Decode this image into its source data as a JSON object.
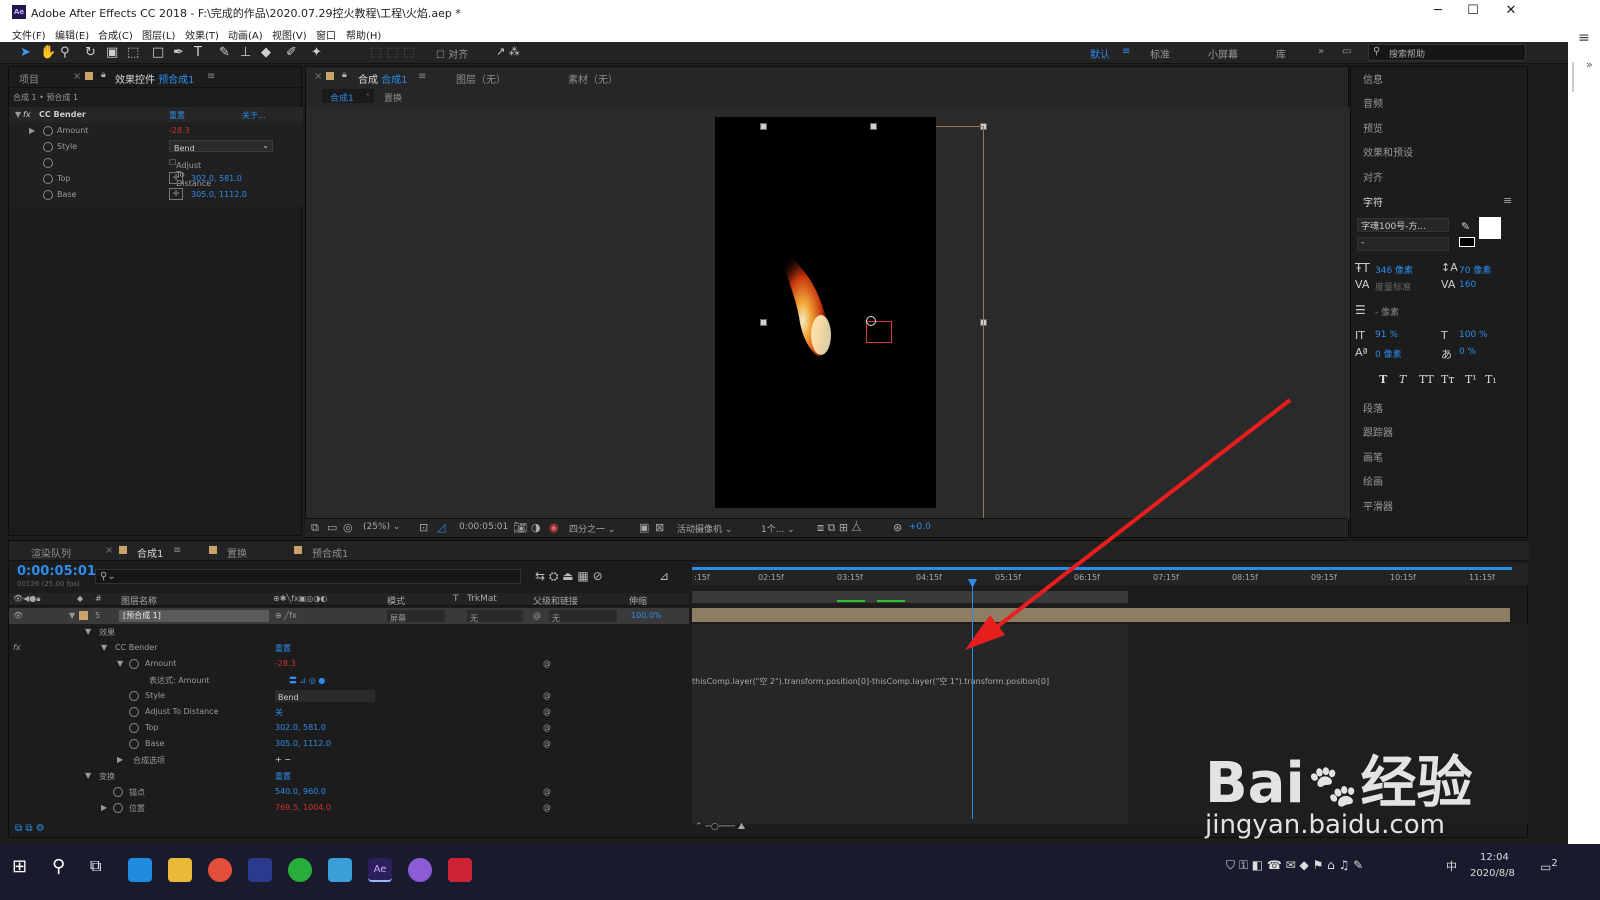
{
  "window": {
    "title": "Adobe After Effects CC 2018 - F:\\完成的作品\\2020.07.29控火教程\\工程\\火焰.aep *",
    "logo": "Ae"
  },
  "menus": [
    "文件(F)",
    "编辑(E)",
    "合成(C)",
    "图层(L)",
    "效果(T)",
    "动画(A)",
    "视图(V)",
    "窗口",
    "帮助(H)"
  ],
  "toolbar": {
    "snap_label": "对齐",
    "workspaces": [
      "默认",
      "标准",
      "小屏幕",
      "库"
    ],
    "search_placeholder": "搜索帮助",
    "workspace_menu_icon": "≡",
    "more_icon": "»"
  },
  "project_panel": {
    "tab_project": "项目",
    "tab_effect_controls": "效果控件",
    "tab_effect_layer": "预合成1",
    "breadcrumb": "合成 1 • 预合成 1",
    "effect": {
      "name": "CC Bender",
      "reset": "重置",
      "about": "关于...",
      "props": [
        {
          "label": "Amount",
          "value": "-28.3"
        },
        {
          "label": "Style",
          "value": "Bend"
        },
        {
          "label": "Adjust To Distance",
          "value": ""
        },
        {
          "label": "Top",
          "value": "302.0, 581.0"
        },
        {
          "label": "Base",
          "value": "305.0, 1112.0"
        }
      ]
    }
  },
  "comp_panel": {
    "tab_comp": "合成",
    "tab_comp_name": "合成1",
    "tab_layer": "图层（无）",
    "tab_footage": "素材（无）",
    "flow_comp": "合成1",
    "flow_replace": "置换",
    "zoom": "(25%)",
    "timecode": "0:00:05:01",
    "resolution": "四分之一",
    "camera": "活动摄像机",
    "views": "1个...",
    "exposure": "+0.0"
  },
  "right_panel": {
    "items_top": [
      "信息",
      "音频",
      "预览",
      "效果和预设",
      "对齐",
      "字符"
    ],
    "font": "字魂100号-方...",
    "font_style": "-",
    "size": "346 像素",
    "leading": "70 像素",
    "kerning": "度量标准",
    "tracking": "160",
    "stroke": "- 像素",
    "vscale": "91 %",
    "hscale": "100 %",
    "baseline": "0 像素",
    "tsume": "0 %",
    "styles": [
      "T",
      "T",
      "TT",
      "Tт",
      "T¹",
      "T₁"
    ],
    "items_bottom": [
      "段落",
      "跟踪器",
      "画笔",
      "绘画",
      "平滑器"
    ]
  },
  "timeline": {
    "tabs": [
      "渲染队列",
      "合成1",
      "置换",
      "预合成1"
    ],
    "timecode": "0:00:05:01",
    "frames": "00126 (25.00 fps)",
    "cols": {
      "name": "图层名称",
      "mode": "模式",
      "t": "T",
      "trkmat": "TrkMat",
      "parent": "父级和链接",
      "stretch": "伸缩",
      "number": "#"
    },
    "layer": {
      "index": "5",
      "name": "[预合成 1]",
      "mode": "屏幕",
      "trkmat": "无",
      "parent": "无",
      "stretch": "100.0%"
    },
    "rows": [
      {
        "label": "效果",
        "value": ""
      },
      {
        "label": "CC Bender",
        "value": "重置"
      },
      {
        "label": "Amount",
        "value": "-28.3"
      },
      {
        "label": "表达式: Amount",
        "value": ""
      },
      {
        "label": "Style",
        "value": "Bend"
      },
      {
        "label": "Adjust To Distance",
        "value": "关"
      },
      {
        "label": "Top",
        "value": "302.0, 581.0"
      },
      {
        "label": "Base",
        "value": "305.0, 1112.0"
      },
      {
        "label": "合成选项",
        "value": ""
      },
      {
        "label": "变换",
        "value": "重置"
      },
      {
        "label": "锚点",
        "value": "540.0, 960.0"
      },
      {
        "label": "位置",
        "value": "769.5, 1004.0"
      }
    ],
    "expression": "thisComp.layer(\"空 2\").transform.position[0]-thisComp.layer(\"空 1\").transform.position[0]",
    "ruler": [
      ":15f",
      "02:15f",
      "03:15f",
      "04:15f",
      "05:15f",
      "06:15f",
      "07:15f",
      "08:15f",
      "09:15f",
      "10:15f",
      "11:15f"
    ],
    "playhead_fraction": 0.335
  },
  "taskbar": {
    "time": "12:04",
    "date": "2020/8/8",
    "ime": "中",
    "notif": "2"
  },
  "watermark": {
    "brand": "Bai",
    "brand2": "经验",
    "url": "jingyan.baidu.com"
  },
  "colors": {
    "accent": "#2d8ceb",
    "red": "#d12f2f",
    "bg": "#1c1c1c",
    "layer_bar": "#8d7e63"
  }
}
